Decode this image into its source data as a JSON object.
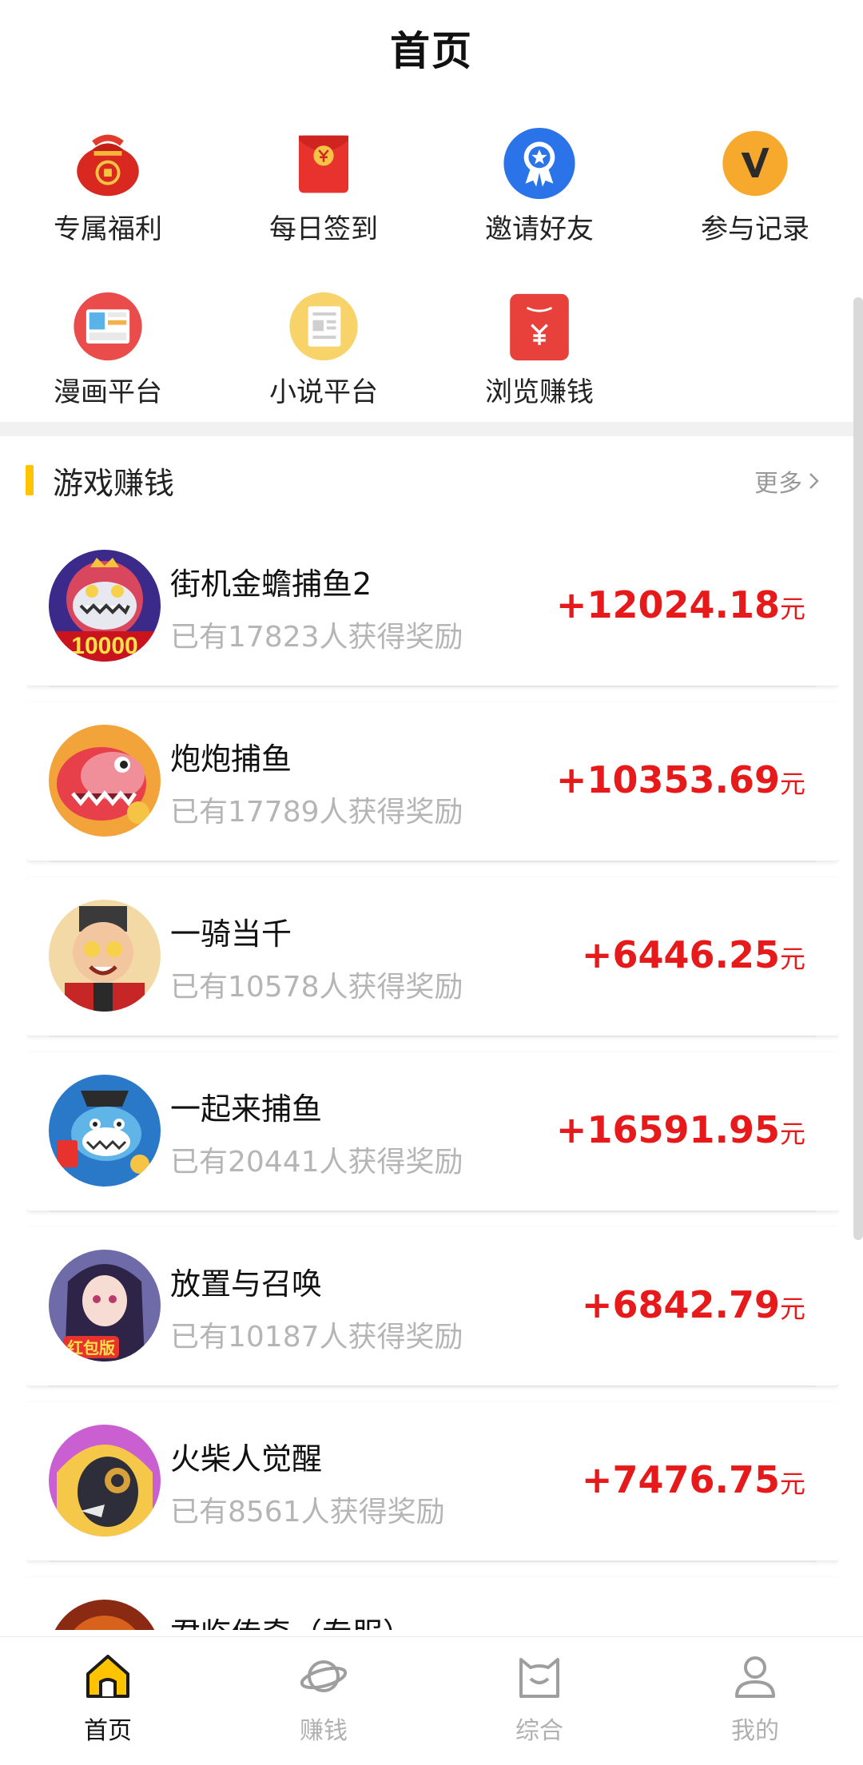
{
  "header": {
    "title": "首页"
  },
  "quick_grid": [
    {
      "label": "专属福利",
      "icon": "lucky-bag-icon"
    },
    {
      "label": "每日签到",
      "icon": "red-envelope-icon"
    },
    {
      "label": "邀请好友",
      "icon": "award-badge-icon"
    },
    {
      "label": "参与记录",
      "icon": "v-badge-icon"
    },
    {
      "label": "漫画平台",
      "icon": "comic-icon"
    },
    {
      "label": "小说平台",
      "icon": "novel-icon"
    },
    {
      "label": "浏览赚钱",
      "icon": "yuan-envelope-icon"
    }
  ],
  "section": {
    "title": "游戏赚钱",
    "more": "更多"
  },
  "games": [
    {
      "title": "街机金蟾捕鱼2",
      "subtitle": "已有17823人获得奖励",
      "reward": "+12024.18",
      "unit": "元"
    },
    {
      "title": "炮炮捕鱼",
      "subtitle": "已有17789人获得奖励",
      "reward": "+10353.69",
      "unit": "元"
    },
    {
      "title": "一骑当千",
      "subtitle": "已有10578人获得奖励",
      "reward": "+6446.25",
      "unit": "元"
    },
    {
      "title": "一起来捕鱼",
      "subtitle": "已有20441人获得奖励",
      "reward": "+16591.95",
      "unit": "元"
    },
    {
      "title": "放置与召唤",
      "subtitle": "已有10187人获得奖励",
      "reward": "+6842.79",
      "unit": "元"
    },
    {
      "title": "火柴人觉醒",
      "subtitle": "已有8561人获得奖励",
      "reward": "+7476.75",
      "unit": "元"
    },
    {
      "title": "君临传奇（专服）",
      "subtitle": "",
      "reward": "",
      "unit": ""
    }
  ],
  "avatar_texts": {
    "game1_badge": "10000",
    "game5_badge": "红包版"
  },
  "tabs": [
    {
      "label": "首页",
      "icon": "home-icon",
      "active": true
    },
    {
      "label": "赚钱",
      "icon": "planet-icon",
      "active": false
    },
    {
      "label": "综合",
      "icon": "cat-face-icon",
      "active": false
    },
    {
      "label": "我的",
      "icon": "user-icon",
      "active": false
    }
  ],
  "colors": {
    "accent": "#FFC300",
    "reward": "#E61A1A",
    "muted": "#B5B5B5"
  }
}
